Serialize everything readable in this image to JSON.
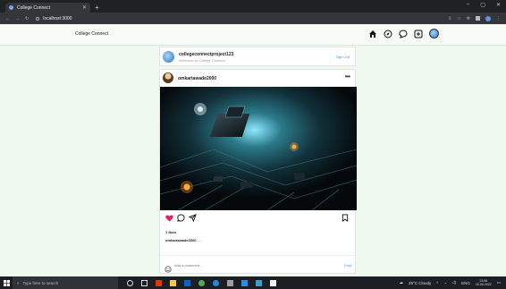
{
  "browser": {
    "tab_title": "College Connect",
    "url": "localhost:3000"
  },
  "header": {
    "brand": "College Connect",
    "icons": [
      "home-icon",
      "explore-icon",
      "messages-icon",
      "create-icon",
      "profile-avatar"
    ]
  },
  "suggestion": {
    "username": "collegeconnectproject123",
    "subtitle": "Welcome to College Connect",
    "action": "Sign Out"
  },
  "post": {
    "username": "omkartawade2000",
    "likes": "1 likes",
    "caption_user": "omkartawade2000",
    "caption_text": "....",
    "comment_placeholder": "Add a comment...",
    "post_label": "Post"
  },
  "taskbar": {
    "search_placeholder": "Type here to search",
    "weather": "25°C Cloudy",
    "lang": "ENG",
    "time": "23:58",
    "date": "15-06-2022"
  },
  "colors": {
    "page_bg": "#f0f9f0",
    "like_red": "#e0245e",
    "link_blue": "#4a90e2"
  }
}
